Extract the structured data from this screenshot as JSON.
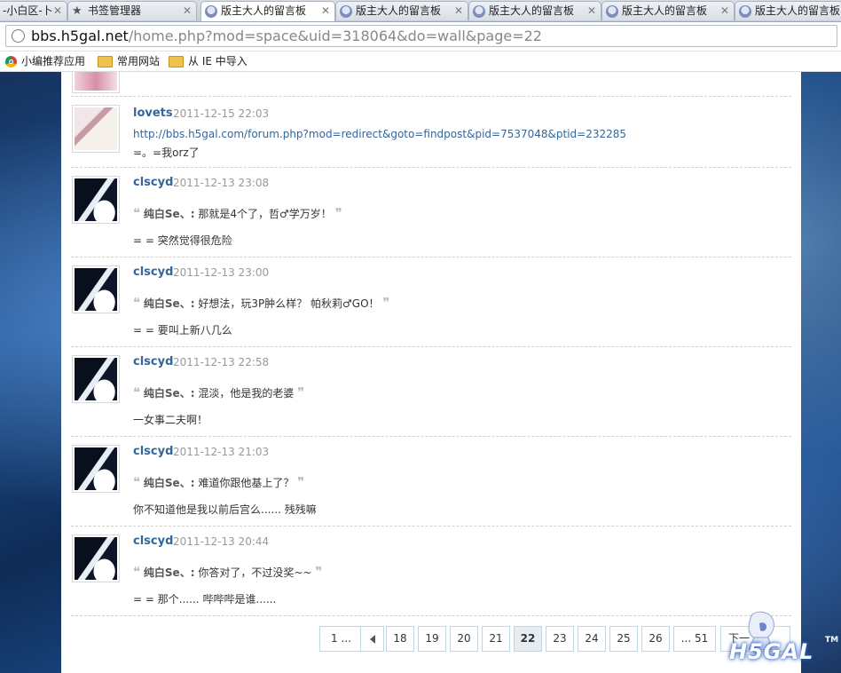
{
  "tabs": [
    {
      "label": "-小白区-卜"
    },
    {
      "label": "书签管理器"
    },
    {
      "label": "版主大人的留言板"
    },
    {
      "label": "版主大人的留言板"
    },
    {
      "label": "版主大人的留言板"
    },
    {
      "label": "版主大人的留言板"
    },
    {
      "label": "版主大人的留言板"
    }
  ],
  "address": {
    "host": "bbs.h5gal.net",
    "path": "/home.php?mod=space&uid=318064&do=wall&page=22"
  },
  "bookmarks": [
    {
      "label": "小编推荐应用",
      "icon": "chrome-icon"
    },
    {
      "label": "常用网站",
      "icon": "folder-icon"
    },
    {
      "label": "从 IE 中导入",
      "icon": "folder-icon"
    }
  ],
  "entries": [
    {
      "user": "lovets",
      "time": "2011-12-15 22:03",
      "link": "http://bbs.h5gal.com/forum.php?mod=redirect&goto=findpost&pid=7537048&ptid=232285",
      "reply": "=。=我orz了"
    },
    {
      "user": "clscyd",
      "time": "2011-12-13 23:08",
      "quote_author": "纯白Se、:",
      "quote_text": "那就是4个了，哲♂学万岁！",
      "reply": "= = 突然觉得很危险"
    },
    {
      "user": "clscyd",
      "time": "2011-12-13 23:00",
      "quote_author": "纯白Se、:",
      "quote_text": "好想法，玩3P肿么样？ 帕秋莉♂GO！",
      "reply": "= = 要叫上新八几么"
    },
    {
      "user": "clscyd",
      "time": "2011-12-13 22:58",
      "quote_author": "纯白Se、:",
      "quote_text": "混淡，他是我的老婆",
      "reply": "一女事二夫啊！"
    },
    {
      "user": "clscyd",
      "time": "2011-12-13 21:03",
      "quote_author": "纯白Se、:",
      "quote_text": "难道你跟他基上了？",
      "reply": "你不知道他是我以前后宫么...... 残残嘛"
    },
    {
      "user": "clscyd",
      "time": "2011-12-13 20:44",
      "quote_author": "纯白Se、:",
      "quote_text": "你答对了，不过没奖~~",
      "reply": "= = 那个...... 哔哔哔是谁......"
    }
  ],
  "pager": {
    "first": "1 ...",
    "pages": [
      "18",
      "19",
      "20",
      "21",
      "22",
      "23",
      "24",
      "25",
      "26"
    ],
    "current": "22",
    "last": "... 51",
    "next": "下一"
  },
  "watermark": {
    "text": "H5GAL",
    "tm": "TM"
  }
}
